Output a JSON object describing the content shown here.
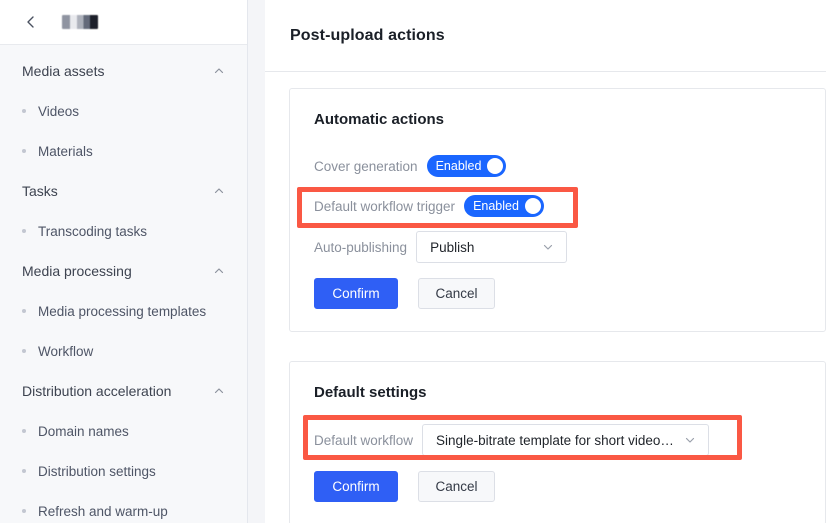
{
  "sidebar": {
    "back_icon": "chevron-left-icon",
    "title_redacted": "",
    "groups": [
      {
        "label": "Media assets",
        "caret_icon": "chevron-up-icon",
        "items": [
          {
            "label": "Videos"
          },
          {
            "label": "Materials"
          }
        ]
      },
      {
        "label": "Tasks",
        "caret_icon": "chevron-up-icon",
        "items": [
          {
            "label": "Transcoding tasks"
          }
        ]
      },
      {
        "label": "Media processing",
        "caret_icon": "chevron-up-icon",
        "items": [
          {
            "label": "Media processing templates"
          },
          {
            "label": "Workflow"
          }
        ]
      },
      {
        "label": "Distribution acceleration",
        "caret_icon": "chevron-up-icon",
        "items": [
          {
            "label": "Domain names"
          },
          {
            "label": "Distribution settings"
          },
          {
            "label": "Refresh and warm-up"
          }
        ]
      }
    ]
  },
  "panel": {
    "title": "Post-upload actions"
  },
  "cards": {
    "automatic_actions": {
      "title": "Automatic actions",
      "cover_generation": {
        "label": "Cover generation",
        "toggle_text": "Enabled",
        "state": "on"
      },
      "default_workflow_trigger": {
        "label": "Default workflow trigger",
        "toggle_text": "Enabled",
        "state": "on"
      },
      "auto_publishing": {
        "label": "Auto-publishing",
        "value": "Publish",
        "caret_icon": "chevron-down-icon"
      },
      "confirm_label": "Confirm",
      "cancel_label": "Cancel"
    },
    "default_settings": {
      "title": "Default settings",
      "default_workflow": {
        "label": "Default workflow",
        "value": "Single-bitrate template for short video f…",
        "caret_icon": "chevron-down-icon"
      },
      "confirm_label": "Confirm",
      "cancel_label": "Cancel"
    }
  },
  "annotations": {
    "color": "#fa5844",
    "boxes": [
      {
        "name": "default-workflow-trigger-row"
      },
      {
        "name": "default-workflow-select-row"
      }
    ]
  },
  "colors": {
    "accent_blue": "#2f5ff5",
    "toggle_blue": "#1a66ff",
    "annotation_red": "#fa5844",
    "page_bg": "#f4f5f8",
    "sidebar_bg": "#f7f8fa"
  }
}
